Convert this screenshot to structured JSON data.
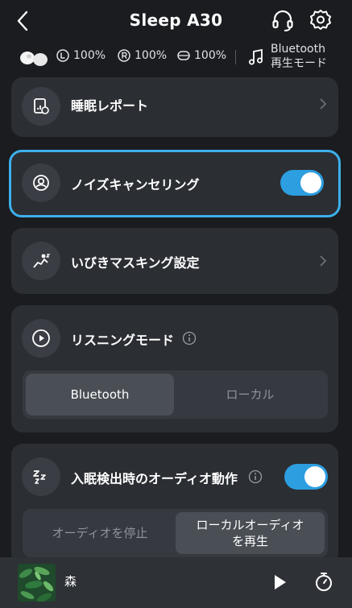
{
  "header": {
    "title": "Sleep A30"
  },
  "status": {
    "left_battery": "100%",
    "right_battery": "100%",
    "case_battery": "100%",
    "mode_line1": "Bluetooth",
    "mode_line2": "再生モード"
  },
  "cards": {
    "sleep_report": {
      "label": "睡眠レポート"
    },
    "noise_cancel": {
      "label": "ノイズキャンセリング",
      "enabled": true
    },
    "snore_masking": {
      "label": "いびきマスキング設定"
    },
    "listening_mode": {
      "label": "リスニングモード",
      "options": [
        "Bluetooth",
        "ローカル"
      ],
      "selected": "Bluetooth"
    },
    "sleep_detect": {
      "label": "入眠検出時のオーディオ動作",
      "enabled": true,
      "options": [
        "オーディオを停止",
        "ローカルオーディオを再生"
      ],
      "selected": "ローカルオーディオを再生"
    }
  },
  "player": {
    "track": "森"
  },
  "colors": {
    "background": "#1a1c20",
    "card": "#2b2e33",
    "accent": "#2d9ee0",
    "highlight_border": "#3db0ec"
  }
}
